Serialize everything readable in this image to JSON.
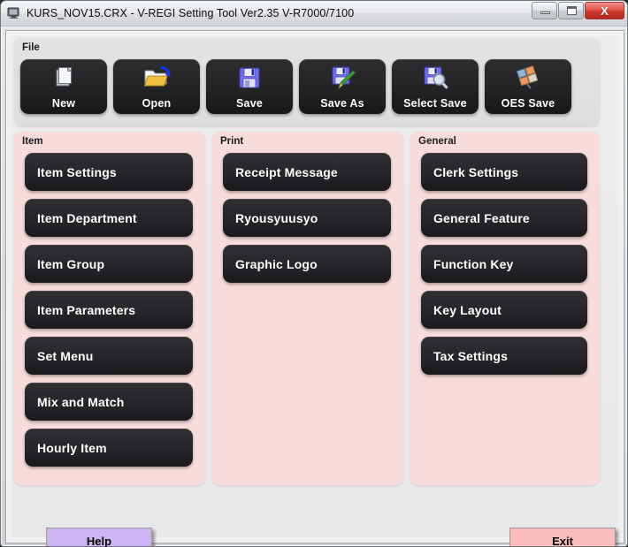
{
  "window": {
    "title": "KURS_NOV15.CRX - V-REGI Setting Tool Ver2.35 V-R7000/7100",
    "app_icon": "monitor-icon",
    "controls": {
      "minimize": "minimize-icon",
      "maximize": "maximize-icon",
      "close": "X"
    }
  },
  "colors": {
    "panel_pink": "#f8dcdc",
    "button_dark": "#26262a",
    "help_button": "#cdb4f2",
    "exit_button": "#fbbcbc",
    "toolbar_gray": "#e3e3e3",
    "close_red": "#cf3a2e"
  },
  "file_group": {
    "legend": "File",
    "buttons": [
      {
        "label": "New",
        "icon": "new-document-icon"
      },
      {
        "label": "Open",
        "icon": "open-folder-icon"
      },
      {
        "label": "Save",
        "icon": "floppy-disk-icon"
      },
      {
        "label": "Save As",
        "icon": "floppy-disk-pencil-icon"
      },
      {
        "label": "Select Save",
        "icon": "floppy-disk-magnifier-icon"
      },
      {
        "label": "OES Save",
        "icon": "tiles-grid-icon"
      }
    ]
  },
  "item_group": {
    "legend": "Item",
    "buttons": [
      {
        "label": "Item Settings"
      },
      {
        "label": "Item Department"
      },
      {
        "label": "Item Group"
      },
      {
        "label": "Item Parameters"
      },
      {
        "label": "Set Menu"
      },
      {
        "label": "Mix and Match"
      },
      {
        "label": "Hourly Item"
      }
    ]
  },
  "print_group": {
    "legend": "Print",
    "buttons": [
      {
        "label": "Receipt Message"
      },
      {
        "label": "Ryousyuusyo"
      },
      {
        "label": "Graphic Logo"
      }
    ]
  },
  "general_group": {
    "legend": "General",
    "buttons": [
      {
        "label": "Clerk Settings"
      },
      {
        "label": "General Feature"
      },
      {
        "label": "Function Key"
      },
      {
        "label": "Key Layout"
      },
      {
        "label": "Tax Settings"
      }
    ]
  },
  "footer": {
    "help_label": "Help",
    "exit_label": "Exit"
  }
}
